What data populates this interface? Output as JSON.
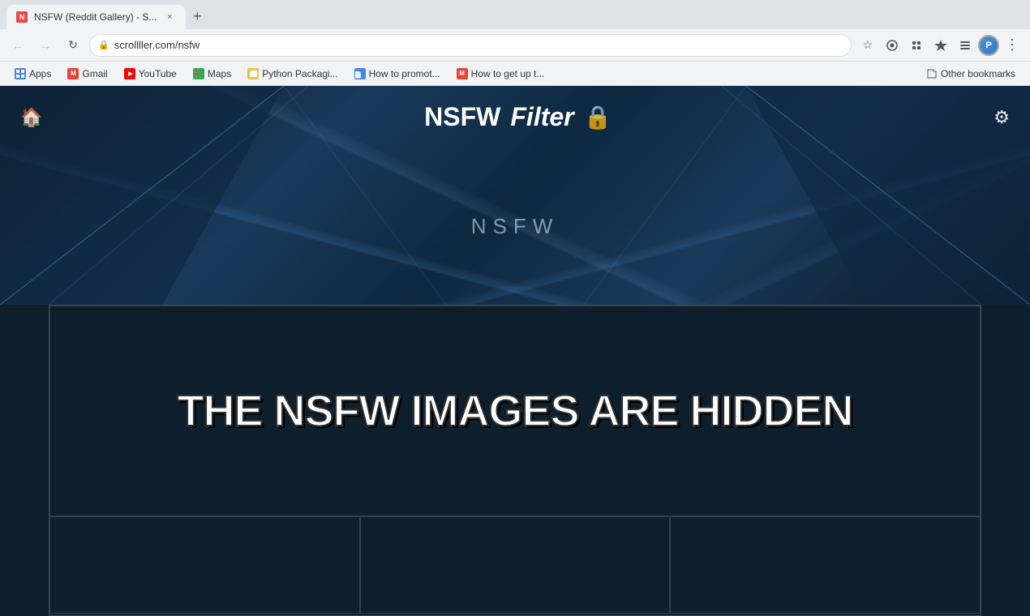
{
  "browser": {
    "tab": {
      "favicon_label": "N",
      "title": "NSFW (Reddit Gallery) - S...",
      "close_label": "×"
    },
    "new_tab_label": "+",
    "nav": {
      "back_label": "←",
      "forward_label": "→",
      "reload_label": "↻",
      "url": "scrollller.com/nsfw",
      "lock_label": "🔒",
      "star_label": "☆",
      "profile_label": "P",
      "menu_label": "⋮"
    },
    "bookmarks": [
      {
        "id": "apps",
        "label": "Apps",
        "icon": "⊞",
        "color": "#4285f4"
      },
      {
        "id": "gmail",
        "label": "Gmail",
        "icon": "M",
        "color": "#ea4335"
      },
      {
        "id": "youtube",
        "label": "YouTube",
        "icon": "▶",
        "color": "#ff0000"
      },
      {
        "id": "maps",
        "label": "Maps",
        "icon": "📍",
        "color": "#34a853"
      },
      {
        "id": "python",
        "label": "Python Packagi...",
        "icon": "📁",
        "color": "#f0a500"
      },
      {
        "id": "promote",
        "label": "How to promot...",
        "icon": "📄",
        "color": "#4285f4"
      },
      {
        "id": "getup",
        "label": "How to get up t...",
        "icon": "M",
        "color": "#e44"
      }
    ],
    "bookmarks_right_label": "Other bookmarks"
  },
  "site": {
    "header": {
      "home_icon": "🏠",
      "title_nsfw": "NSFW",
      "title_filter": "Filter",
      "lock_icon": "🔒",
      "settings_icon": "⚙",
      "center_label": "NSFW"
    },
    "hidden_message": "THE NSFW IMAGES ARE HIDDEN"
  }
}
